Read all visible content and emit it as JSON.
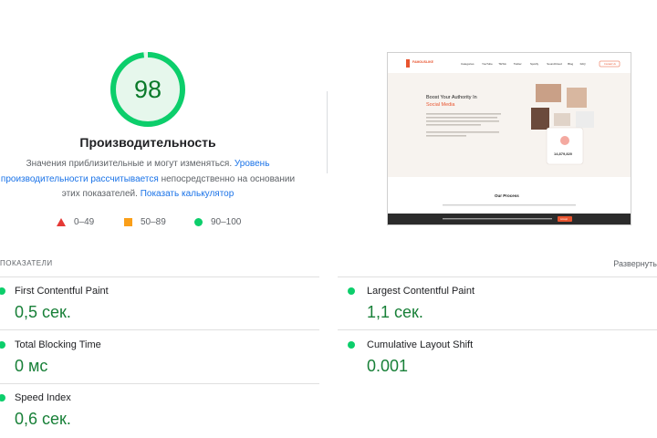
{
  "gauge": {
    "score": "98",
    "fraction": 0.98,
    "color": "#0cce6b"
  },
  "performance": {
    "title": "Производительность",
    "desc_1": "Значения приблизительные и могут изменяться.",
    "link_1": "Уровень производительности рассчитывается",
    "desc_2": "непосредственно на основании этих показателей.",
    "link_2": "Показать калькулятор"
  },
  "legend": {
    "poor": "0–49",
    "average": "50–89",
    "good": "90–100"
  },
  "preview": {
    "logo": "FAMOUSLIKE",
    "nav": [
      "Categories",
      "YouTube",
      "TikTok",
      "Twitter",
      "Spotify",
      "SoundCloud",
      "Blog",
      "FAQ"
    ],
    "nav_button": "Contact Us",
    "hero_title_1": "Boost Your Authority In",
    "hero_title_2": "Social Media",
    "counter": "14,879,820",
    "process_title": "Our Process",
    "cookie_button": "Accept"
  },
  "metrics_section": {
    "title": "ПОКАЗАТЕЛИ",
    "expand": "Развернуть"
  },
  "metrics": {
    "fcp": {
      "name": "First Contentful Paint",
      "value": "0,5 сек."
    },
    "lcp": {
      "name": "Largest Contentful Paint",
      "value": "1,1 сек."
    },
    "tbt": {
      "name": "Total Blocking Time",
      "value": "0 мс"
    },
    "cls": {
      "name": "Cumulative Layout Shift",
      "value": "0.001"
    },
    "si": {
      "name": "Speed Index",
      "value": "0,6 сек."
    }
  }
}
